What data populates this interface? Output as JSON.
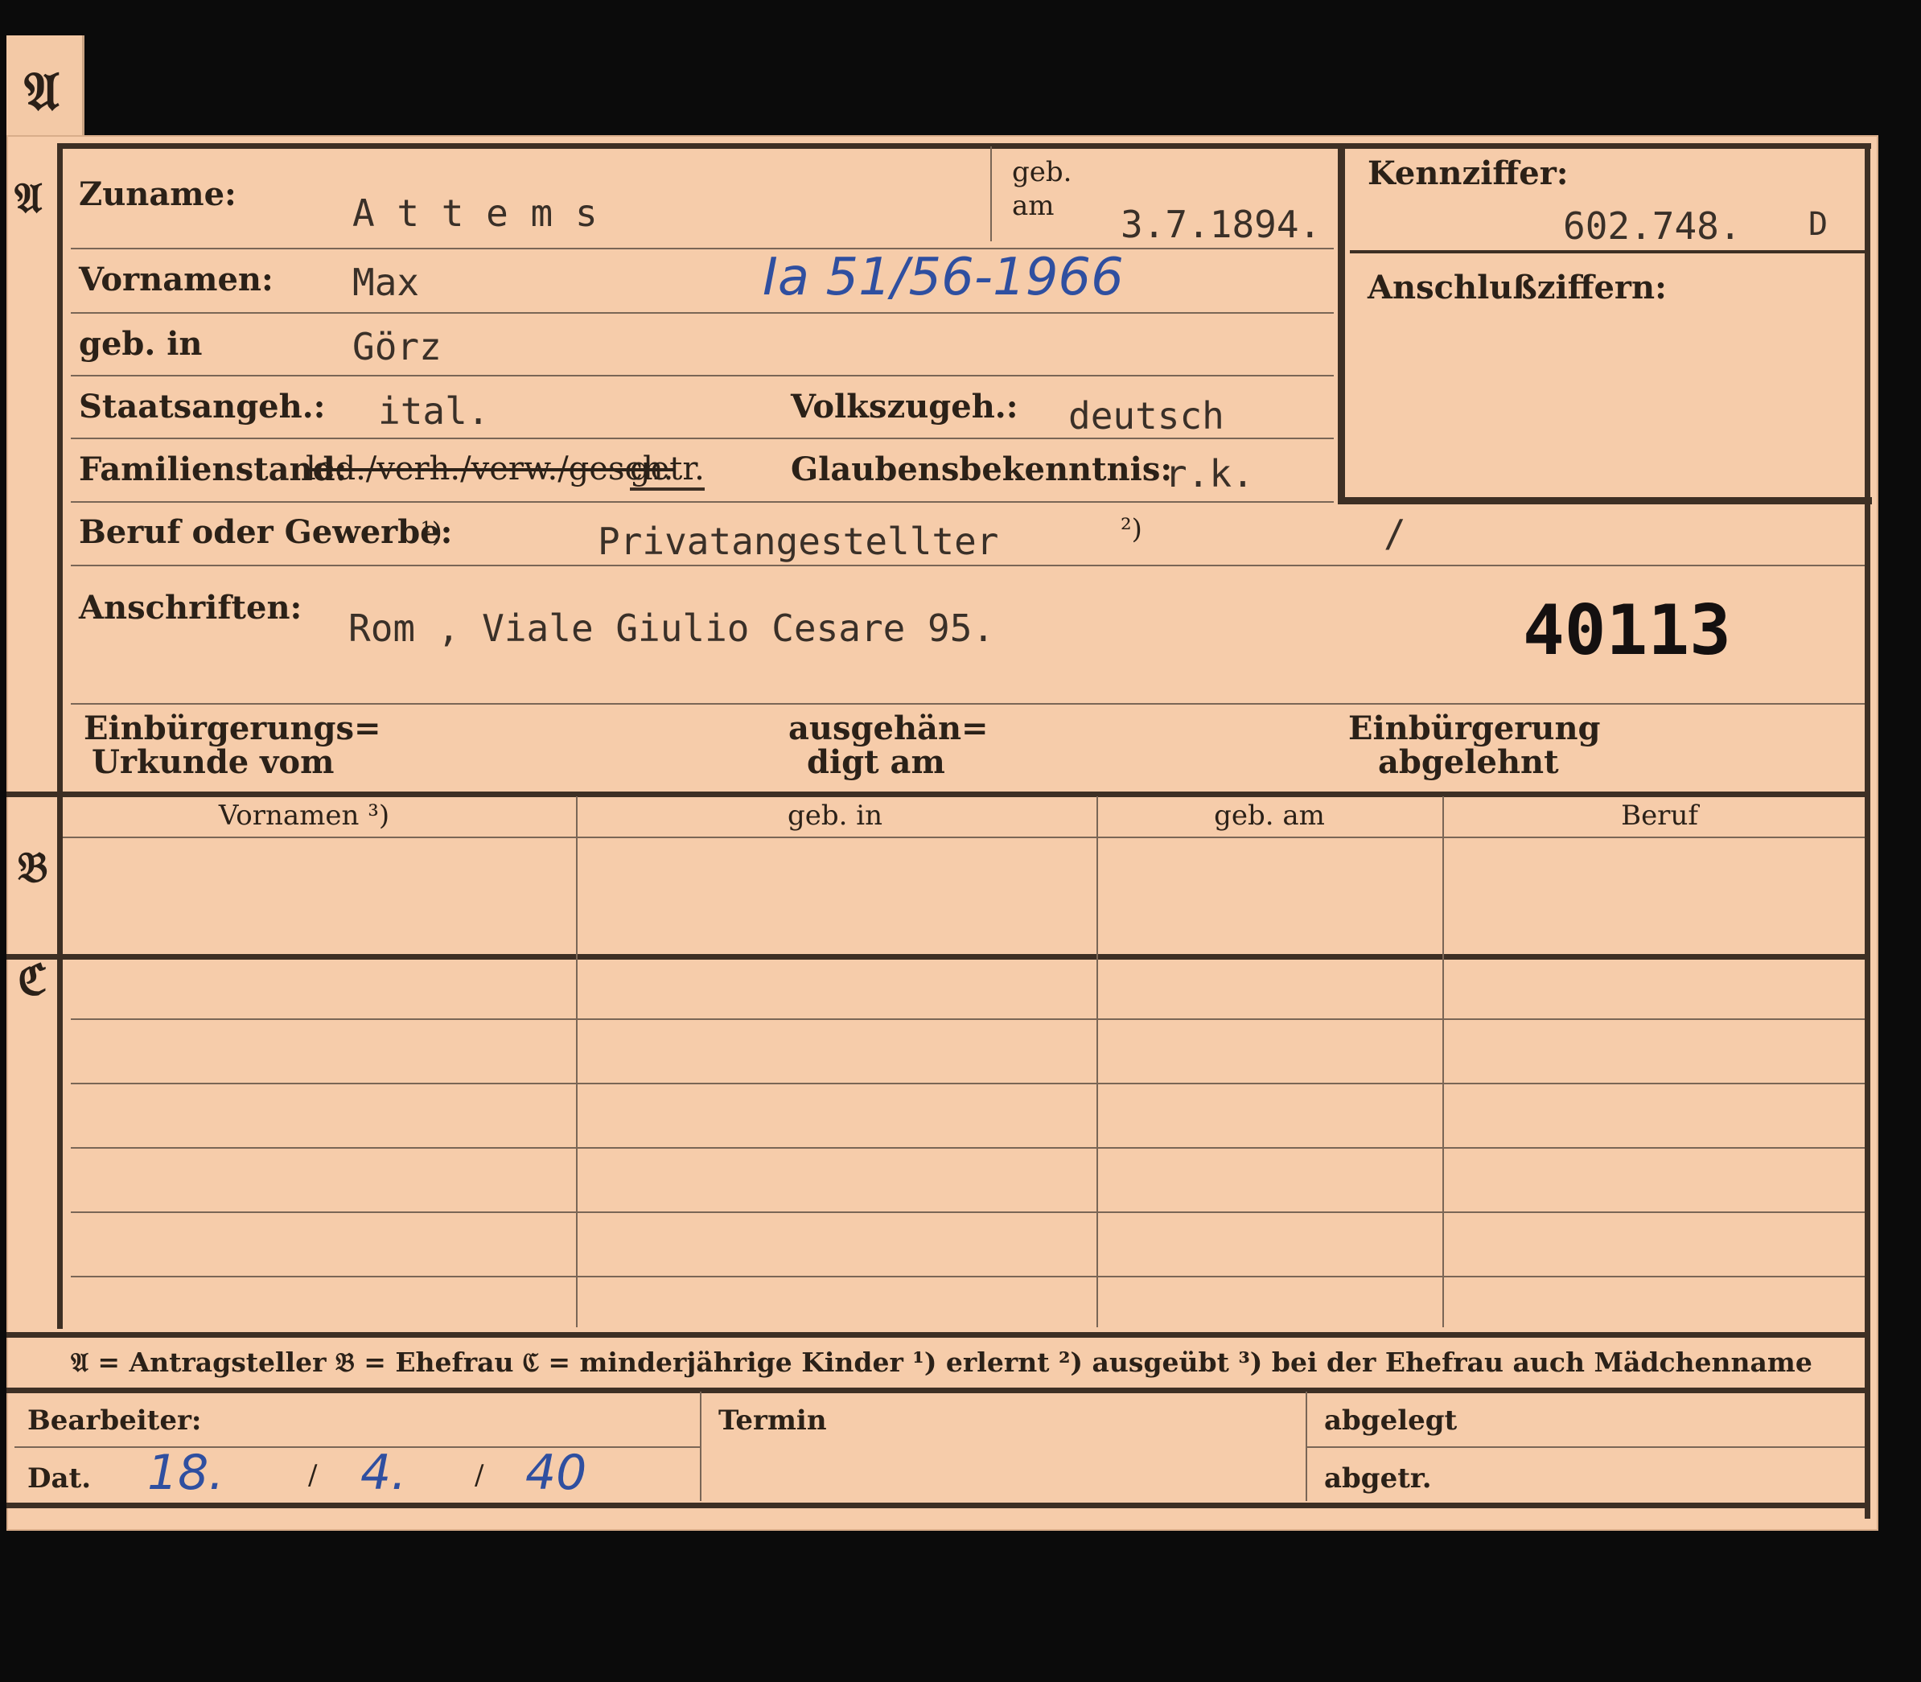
{
  "sections": {
    "a": "𝔄",
    "b": "𝔅",
    "c": "ℭ"
  },
  "fields": {
    "zuname_label": "Zuname:",
    "zuname_value": "A t t e m s",
    "geb_label_1": "geb.",
    "geb_label_2": "am",
    "geb_am_value": "3.7.1894.",
    "kennziffer_label": "Kennziffer:",
    "kennziffer_value": "602.748.",
    "kennziffer_suffix": "D",
    "anschluss_label": "Anschlußziffern:",
    "vornamen_label": "Vornamen:",
    "vornamen_value": "Max",
    "handwritten_ref": "Ia 51/56-1966",
    "geb_in_label": "geb. in",
    "geb_in_value": "Görz",
    "staatsangeh_label": "Staatsangeh.:",
    "staatsangeh_value": "ital.",
    "volkszugeh_label": "Volkszugeh.:",
    "volkszugeh_value": "deutsch",
    "familienstand_label": "Familienstand:",
    "familienstand_struck": "led./verh./verw./gesch.",
    "familienstand_value": "getr.",
    "glauben_label": "Glaubensbekenntnis:",
    "glauben_value": "r.k.",
    "beruf_label": "Beruf oder Gewerbe:",
    "beruf_note1": "¹)",
    "beruf_value": "Privatangestellter",
    "beruf_note2": "²)",
    "beruf_slash": "/",
    "anschriften_label": "Anschriften:",
    "anschriften_value": "Rom , Viale  Giulio Cesare 95.",
    "stamp_number": "40113",
    "einb_urkunde_1": "Einbürgerungs=",
    "einb_urkunde_2": "Urkunde vom",
    "ausgehaen_1": "ausgehän=",
    "ausgehaen_2": "digt am",
    "einb_abgelehnt_1": "Einbürgerung",
    "einb_abgelehnt_2": "abgelehnt"
  },
  "table_headers": [
    "Vornamen ³)",
    "geb. in",
    "geb. am",
    "Beruf"
  ],
  "legend": "𝔄 = Antragsteller   𝔅 = Ehefrau   ℭ = minderjährige Kinder   ¹) erlernt   ²) ausgeübt   ³) bei der Ehefrau auch Mädchenname",
  "footer": {
    "bearbeiter_label": "Bearbeiter:",
    "dat_label": "Dat.",
    "dat_day": "18.",
    "dat_month": "4.",
    "dat_year": "40",
    "sep1": "/",
    "sep2": "/",
    "termin_label": "Termin",
    "abgelegt_label": "abgelegt",
    "abgetr_label": "abgetr."
  },
  "colors": {
    "card": "#f6ccaa",
    "ink": "#2b2118",
    "pen": "#2f4fa0",
    "background": "#0b0b0b"
  }
}
